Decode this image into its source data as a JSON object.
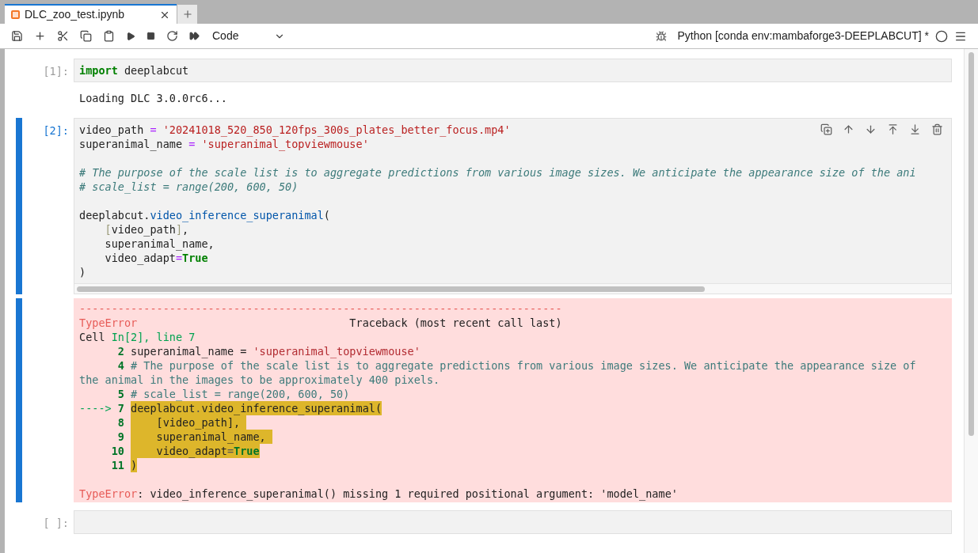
{
  "tabs": [
    {
      "title": "DLC_zoo_test.ipynb",
      "selected": true
    }
  ],
  "toolbar": {
    "cell_type": "Code",
    "kernel": "Python [conda env:mambaforge3-DEEPLABCUT] *"
  },
  "cells": [
    {
      "prompt": "[1]:",
      "selected": false,
      "lines": [
        {
          "kind": "code",
          "tokens": [
            {
              "kind": "keyword",
              "text": "import"
            },
            {
              "kind": "name",
              "text": " deeplabcut"
            }
          ]
        }
      ],
      "outputs": [
        {
          "kind": "stream",
          "text": "Loading DLC 3.0.0rc6..."
        }
      ]
    },
    {
      "prompt": "[2]:",
      "selected": true,
      "lines": [
        {
          "kind": "code",
          "tokens": [
            {
              "kind": "name",
              "text": "video_path "
            },
            {
              "kind": "operator",
              "text": "= "
            },
            {
              "kind": "string",
              "text": "'20241018_520_850_120fps_300s_plates_better_focus.mp4'"
            }
          ]
        },
        {
          "kind": "code",
          "tokens": [
            {
              "kind": "name",
              "text": "superanimal_name "
            },
            {
              "kind": "operator",
              "text": "= "
            },
            {
              "kind": "string",
              "text": "'superanimal_topviewmouse'"
            }
          ]
        },
        {
          "kind": "blank"
        },
        {
          "kind": "code",
          "tokens": [
            {
              "kind": "comment",
              "text": "# The purpose of the scale list is to aggregate predictions from various image sizes. We anticipate the appearance size of the ani"
            }
          ]
        },
        {
          "kind": "code",
          "tokens": [
            {
              "kind": "comment",
              "text": "# scale_list = range(200, 600, 50)"
            }
          ]
        },
        {
          "kind": "blank"
        },
        {
          "kind": "code",
          "tokens": [
            {
              "kind": "name",
              "text": "deeplabcut."
            },
            {
              "kind": "function",
              "text": "video_inference_superanimal"
            },
            {
              "kind": "name",
              "text": "("
            }
          ]
        },
        {
          "kind": "code",
          "tokens": [
            {
              "kind": "bracket",
              "text": "    ["
            },
            {
              "kind": "name",
              "text": "video_path"
            },
            {
              "kind": "bracket",
              "text": "]"
            },
            {
              "kind": "name",
              "text": ","
            }
          ]
        },
        {
          "kind": "code",
          "tokens": [
            {
              "kind": "name",
              "text": "    superanimal_name,"
            }
          ]
        },
        {
          "kind": "code",
          "tokens": [
            {
              "kind": "name",
              "text": "    video_adapt"
            },
            {
              "kind": "operator",
              "text": "="
            },
            {
              "kind": "keyword",
              "text": "True"
            }
          ]
        },
        {
          "kind": "code",
          "tokens": [
            {
              "kind": "name",
              "text": ")"
            }
          ]
        }
      ],
      "outputs": [
        {
          "kind": "error",
          "lines": [
            {
              "kind": "text",
              "tokens": [
                {
                  "kind": "red",
                  "text": "---------------------------------------------------------------------------"
                }
              ]
            },
            {
              "kind": "text",
              "tokens": [
                {
                  "kind": "red",
                  "text": "TypeError"
                },
                {
                  "kind": "plain",
                  "text": "                                 Traceback (most recent call last)"
                }
              ]
            },
            {
              "kind": "text",
              "tokens": [
                {
                  "kind": "plain",
                  "text": "Cell "
                },
                {
                  "kind": "green",
                  "text": "In[2], line 7"
                }
              ]
            },
            {
              "kind": "source",
              "number": "2",
              "highlighted": false,
              "tokens": [
                {
                  "kind": "plain",
                  "text": "superanimal_name = "
                },
                {
                  "kind": "string",
                  "text": "'superanimal_topviewmouse'"
                }
              ]
            },
            {
              "kind": "source",
              "number": "4",
              "highlighted": false,
              "tokens": [
                {
                  "kind": "comment",
                  "text": "# The purpose of the scale list is to aggregate predictions from various image sizes. We anticipate the appearance size of"
                }
              ]
            },
            {
              "kind": "text",
              "tokens": [
                {
                  "kind": "comment",
                  "text": "the animal in the images to be approximately 400 pixels."
                }
              ]
            },
            {
              "kind": "source",
              "number": "5",
              "highlighted": false,
              "tokens": [
                {
                  "kind": "comment",
                  "text": "# scale_list = range(200, 600, 50)"
                }
              ]
            },
            {
              "kind": "source",
              "arrow": "---->",
              "number": "7",
              "highlighted": true,
              "tokens": [
                {
                  "kind": "plain",
                  "text": "deeplabcut"
                },
                {
                  "kind": "dim",
                  "text": "."
                },
                {
                  "kind": "plain",
                  "text": "video_inference_superanimal("
                }
              ]
            },
            {
              "kind": "source",
              "number": "8",
              "highlighted": true,
              "tokens": [
                {
                  "kind": "plain",
                  "text": "    [video_path], "
                }
              ]
            },
            {
              "kind": "source",
              "number": "9",
              "highlighted": true,
              "tokens": [
                {
                  "kind": "plain",
                  "text": "    superanimal_name, "
                }
              ]
            },
            {
              "kind": "source",
              "number": "10",
              "highlighted": true,
              "tokens": [
                {
                  "kind": "plain",
                  "text": "    video_adapt"
                },
                {
                  "kind": "dim",
                  "text": "="
                },
                {
                  "kind": "keyword",
                  "text": "True"
                }
              ]
            },
            {
              "kind": "source",
              "number": "11",
              "highlighted": true,
              "tokens": [
                {
                  "kind": "plain",
                  "text": ")"
                }
              ]
            },
            {
              "kind": "blank"
            },
            {
              "kind": "text",
              "tokens": [
                {
                  "kind": "red",
                  "text": "TypeError"
                },
                {
                  "kind": "plain",
                  "text": ": video_inference_superanimal() missing 1 required positional argument: 'model_name'"
                }
              ]
            }
          ]
        }
      ]
    },
    {
      "prompt": "[ ]:",
      "selected": false,
      "lines": [
        {
          "kind": "blank"
        }
      ]
    }
  ]
}
